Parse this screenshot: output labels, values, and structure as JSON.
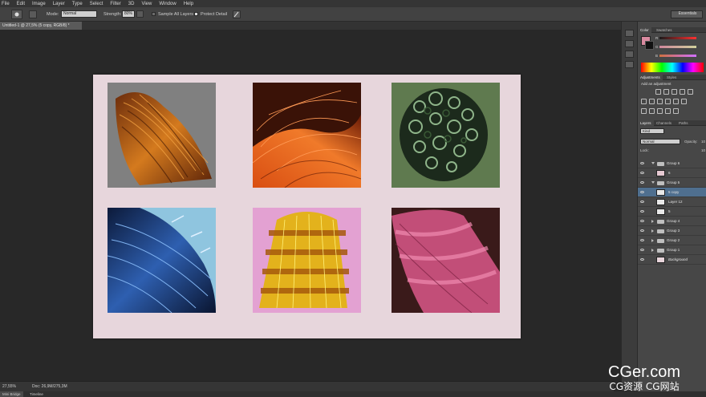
{
  "menu": [
    "File",
    "Edit",
    "Image",
    "Layer",
    "Type",
    "Select",
    "Filter",
    "3D",
    "View",
    "Window",
    "Help"
  ],
  "options": {
    "mode_label": "Mode:",
    "mode_value": "Normal",
    "strength_label": "Strength:",
    "strength_value": "80%",
    "sample_all": "Sample All Layers",
    "protect_detail": "Protect Detail",
    "workspace": "Essentials"
  },
  "document_tab": "Untitled-1 @ 27,5% (5 copy, RGB/8) *",
  "status": {
    "zoom": "27,55%",
    "doc": "Doc: 26,9M/275,3M"
  },
  "bottom_tabs": [
    "Mini Bridge",
    "Timeline"
  ],
  "color_panel": {
    "tabs": [
      "Color",
      "Swatches"
    ],
    "channels": [
      "R",
      "G",
      "B"
    ],
    "fg_color": "#d98aa0",
    "bg_color": "#111111"
  },
  "adjustments": {
    "tabs": [
      "Adjustments",
      "Styles"
    ],
    "title": "Add an adjustment"
  },
  "layers_panel": {
    "tabs": [
      "Layers",
      "Channels",
      "Paths"
    ],
    "kind": "Kind",
    "blend": "Normal",
    "opacity_label": "Opacity:",
    "opacity_value": "10",
    "lock_label": "Lock:",
    "fill_value": "10",
    "layers": [
      {
        "name": "Group 6",
        "type": "group",
        "open": true,
        "selected": false
      },
      {
        "name": "6",
        "type": "layer",
        "selected": false,
        "thumb": "#e6c9d2"
      },
      {
        "name": "Group 5",
        "type": "group",
        "open": true,
        "selected": false
      },
      {
        "name": "5 copy",
        "type": "layer",
        "selected": true,
        "thumb": "#e8e8e8"
      },
      {
        "name": "Layer 12",
        "type": "layer",
        "selected": false,
        "thumb": "#e8e8e8"
      },
      {
        "name": "5",
        "type": "layer",
        "selected": false,
        "thumb": "#e8e8e8"
      },
      {
        "name": "Group 4",
        "type": "group",
        "open": false,
        "selected": false
      },
      {
        "name": "Group 3",
        "type": "group",
        "open": false,
        "selected": false
      },
      {
        "name": "Group 2",
        "type": "group",
        "open": false,
        "selected": false
      },
      {
        "name": "Group 1",
        "type": "group",
        "open": false,
        "selected": false
      },
      {
        "name": "Background",
        "type": "layer",
        "selected": false,
        "thumb": "#e8d5db"
      }
    ]
  },
  "artwork": {
    "background_color": "#e7d6dc",
    "tiles": [
      {
        "name": "auburn-hair",
        "bg": "#808080"
      },
      {
        "name": "red-hair",
        "bg": "#3a1207"
      },
      {
        "name": "curly-green-hair",
        "bg": "#5f7a4f"
      },
      {
        "name": "blue-hair",
        "bg": "#8fc5df"
      },
      {
        "name": "blonde-hair",
        "bg": "#e3a1d2"
      },
      {
        "name": "pink-hair",
        "bg": "#3a1a1a"
      }
    ]
  },
  "watermark": {
    "title": "CGer.com",
    "subtitle": "CG资源 CG网站"
  }
}
